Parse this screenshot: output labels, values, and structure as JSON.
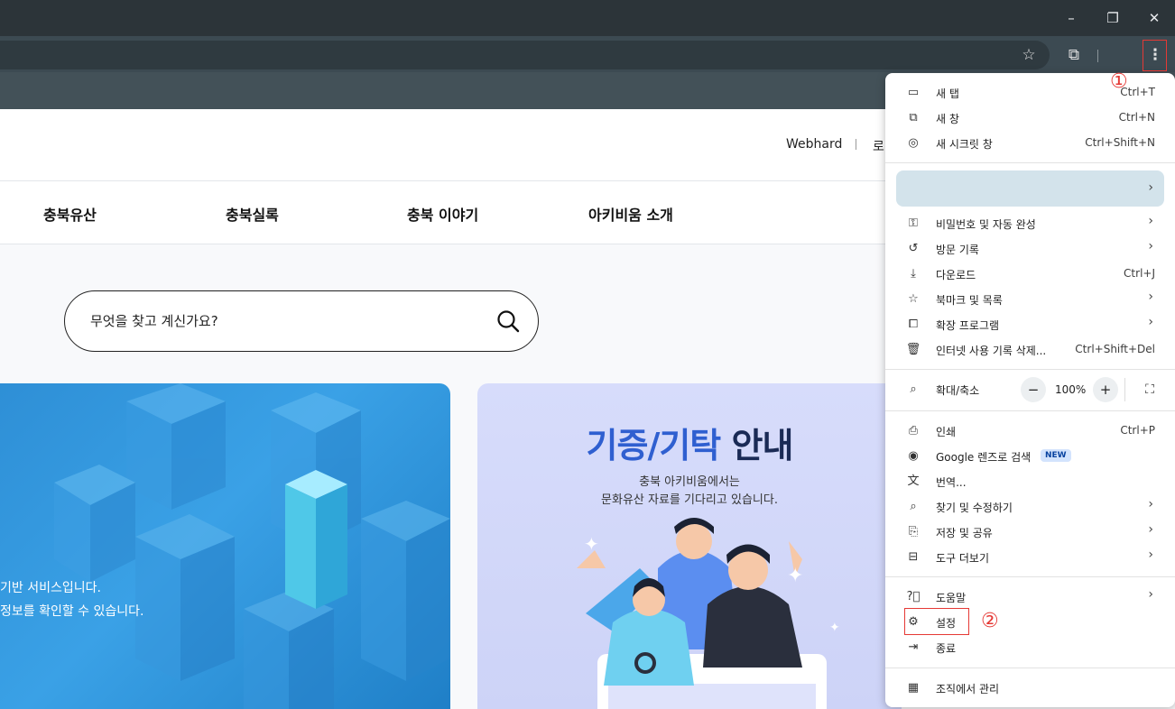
{
  "window_controls": {
    "minimize": "–",
    "restore": "❐",
    "close": "✕"
  },
  "toolbar": {
    "bookmark_star": "☆",
    "extensions_icon": "⧉",
    "menu_icon": "⋮"
  },
  "site": {
    "header": {
      "webhard": "Webhard",
      "separator": "|",
      "login_partial": "로"
    },
    "nav": [
      "충북유산",
      "충북실록",
      "충북 이야기",
      "아키비움 소개"
    ],
    "search": {
      "placeholder": "무엇을 찾고 계신가요?"
    },
    "banner_left": {
      "line1": "기반 서비스입니다.",
      "line2": "정보를 확인할 수 있습니다."
    },
    "banner_right": {
      "title_part1": "기증/기탁",
      "title_part2": "안내",
      "sub1": "충북 아키비움에서는",
      "sub2": "문화유산 자료를 기다리고 있습니다."
    }
  },
  "menu": {
    "new_tab": {
      "label": "새 탭",
      "shortcut": "Ctrl+T"
    },
    "new_window": {
      "label": "새 창",
      "shortcut": "Ctrl+N"
    },
    "incognito": {
      "label": "새 시크릿 창",
      "shortcut": "Ctrl+Shift+N"
    },
    "passwords": {
      "label": "비밀번호 및 자동 완성"
    },
    "history": {
      "label": "방문 기록"
    },
    "downloads": {
      "label": "다운로드",
      "shortcut": "Ctrl+J"
    },
    "bookmarks": {
      "label": "북마크 및 목록"
    },
    "extensions": {
      "label": "확장 프로그램"
    },
    "clear_data": {
      "label": "인터넷 사용 기록 삭제...",
      "shortcut": "Ctrl+Shift+Del"
    },
    "zoom": {
      "label": "확대/축소",
      "minus": "−",
      "value": "100%",
      "plus": "+"
    },
    "print": {
      "label": "인쇄",
      "shortcut": "Ctrl+P"
    },
    "lens": {
      "label": "Google 렌즈로 검색",
      "badge": "NEW"
    },
    "translate": {
      "label": "번역..."
    },
    "find_edit": {
      "label": "찾기 및 수정하기"
    },
    "save_share": {
      "label": "저장 및 공유"
    },
    "more_tools": {
      "label": "도구 더보기"
    },
    "help": {
      "label": "도움말"
    },
    "settings": {
      "label": "설정"
    },
    "exit": {
      "label": "종료"
    },
    "managed": {
      "label": "조직에서 관리"
    }
  },
  "annotations": {
    "step1": "①",
    "step2": "②",
    "accent": "#e53935"
  }
}
